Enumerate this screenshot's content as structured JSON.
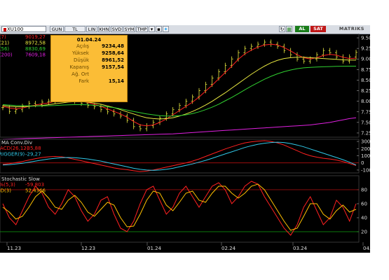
{
  "toolbar": {
    "symbol": "XU100",
    "period_buttons": [
      "GUN",
      "TL",
      "LIN",
      "KHN",
      "SVD",
      "SYM",
      "TMP"
    ],
    "al_label": "AL",
    "sat_label": "SAT",
    "brand": "MATRIKS",
    "colors": {
      "al": "#1a7d1a",
      "sat": "#c01818"
    }
  },
  "tooltip": {
    "date": "01.04.24",
    "rows": [
      {
        "key": "Açılış",
        "value": "9234,48"
      },
      {
        "key": "Yüksek",
        "value": "9258,64"
      },
      {
        "key": "Düşük",
        "value": "8961,52"
      },
      {
        "key": "Kapanış",
        "value": "9157,54"
      },
      {
        "key": "Ağ. Ort",
        "value": ""
      },
      {
        "key": "Fark",
        "value": "15,14"
      }
    ]
  },
  "chart_data": [
    {
      "type": "line",
      "panel": "price",
      "title": "",
      "ma_legend": [
        {
          "label": "V(7)",
          "value": "9019,27",
          "color": "#ff2020"
        },
        {
          "label": "V(21)",
          "value": "8972,58",
          "color": "#e8e840"
        },
        {
          "label": "V(56)",
          "value": "8830,69",
          "color": "#30d030"
        },
        {
          "label": "V(200)",
          "value": "7609,18",
          "color": "#e020e0"
        }
      ],
      "y_ticks": [
        "9.500",
        "9.250",
        "9.000",
        "8.750",
        "8.500",
        "8.250",
        "8.000",
        "7.750",
        "7.500",
        "7.250"
      ],
      "ylim": [
        7150,
        9600
      ],
      "x_ticks": [
        "11.23",
        "12.23",
        "01.24",
        "02.24",
        "03.24",
        "04.24"
      ],
      "close": [
        7850,
        7760,
        7800,
        7880,
        7950,
        7920,
        7980,
        8000,
        8050,
        8100,
        8060,
        8000,
        7950,
        7900,
        7870,
        7800,
        7750,
        7700,
        7650,
        7550,
        7400,
        7350,
        7420,
        7500,
        7600,
        7700,
        7800,
        7900,
        8000,
        8100,
        8250,
        8400,
        8550,
        8700,
        8850,
        9000,
        9150,
        9250,
        9300,
        9350,
        9400,
        9350,
        9300,
        9200,
        9100,
        9000,
        8950,
        9000,
        9100,
        9200,
        9150,
        9050,
        8950,
        9050,
        9157
      ],
      "series": [
        {
          "name": "V(7)",
          "color": "#ff2020",
          "values": [
            7880,
            7840,
            7820,
            7840,
            7880,
            7910,
            7940,
            7960,
            8000,
            8040,
            8050,
            8040,
            8010,
            7970,
            7930,
            7880,
            7820,
            7760,
            7700,
            7620,
            7520,
            7440,
            7420,
            7440,
            7500,
            7580,
            7680,
            7780,
            7880,
            7980,
            8100,
            8240,
            8380,
            8530,
            8680,
            8830,
            8990,
            9120,
            9210,
            9280,
            9330,
            9350,
            9330,
            9270,
            9190,
            9100,
            9030,
            9000,
            9030,
            9080,
            9110,
            9090,
            9040,
            9010,
            9019
          ]
        },
        {
          "name": "V(21)",
          "color": "#e8e840",
          "values": [
            7900,
            7880,
            7870,
            7870,
            7880,
            7890,
            7900,
            7920,
            7940,
            7960,
            7980,
            7990,
            7990,
            7980,
            7960,
            7930,
            7890,
            7850,
            7800,
            7750,
            7700,
            7650,
            7610,
            7590,
            7580,
            7590,
            7610,
            7650,
            7700,
            7760,
            7830,
            7910,
            8000,
            8100,
            8200,
            8310,
            8420,
            8530,
            8640,
            8740,
            8830,
            8910,
            8970,
            9010,
            9030,
            9040,
            9040,
            9030,
            9020,
            9010,
            9000,
            8990,
            8980,
            8975,
            8972
          ]
        },
        {
          "name": "V(56)",
          "color": "#30d030",
          "values": [
            7920,
            7910,
            7900,
            7895,
            7890,
            7890,
            7890,
            7895,
            7900,
            7910,
            7915,
            7920,
            7920,
            7915,
            7905,
            7890,
            7870,
            7850,
            7820,
            7790,
            7760,
            7730,
            7700,
            7680,
            7660,
            7650,
            7650,
            7660,
            7680,
            7710,
            7750,
            7800,
            7860,
            7930,
            8010,
            8090,
            8180,
            8270,
            8360,
            8440,
            8520,
            8590,
            8650,
            8700,
            8740,
            8770,
            8790,
            8800,
            8810,
            8815,
            8820,
            8825,
            8828,
            8830,
            8830
          ]
        },
        {
          "name": "V(200)",
          "color": "#e020e0",
          "values": [
            7100,
            7105,
            7110,
            7115,
            7120,
            7125,
            7130,
            7135,
            7140,
            7145,
            7150,
            7155,
            7160,
            7165,
            7170,
            7175,
            7180,
            7185,
            7190,
            7195,
            7200,
            7205,
            7210,
            7215,
            7220,
            7225,
            7230,
            7240,
            7250,
            7260,
            7270,
            7280,
            7290,
            7300,
            7310,
            7320,
            7330,
            7340,
            7350,
            7360,
            7370,
            7380,
            7390,
            7400,
            7410,
            7420,
            7430,
            7440,
            7460,
            7480,
            7500,
            7530,
            7560,
            7590,
            7609
          ]
        }
      ]
    },
    {
      "type": "line",
      "panel": "macd",
      "title": "MA Conv.Div",
      "legend": [
        {
          "label": "MACD(26,12)",
          "value": "-35,88",
          "color": "#ff2020"
        },
        {
          "label": "TRIGGER(9)",
          "value": "-29,27",
          "color": "#30c8e8"
        }
      ],
      "y_ticks": [
        "300",
        "200",
        "100",
        "0",
        "-100"
      ],
      "ylim": [
        -140,
        330
      ],
      "series": [
        {
          "name": "MACD(26,12)",
          "color": "#ff2020",
          "values": [
            -20,
            -10,
            5,
            20,
            40,
            60,
            75,
            85,
            90,
            85,
            70,
            50,
            30,
            10,
            -10,
            -30,
            -50,
            -70,
            -85,
            -95,
            -110,
            -120,
            -115,
            -100,
            -80,
            -60,
            -40,
            -20,
            0,
            25,
            55,
            90,
            125,
            160,
            195,
            225,
            255,
            280,
            295,
            305,
            310,
            300,
            280,
            250,
            210,
            170,
            130,
            100,
            80,
            65,
            55,
            40,
            20,
            -10,
            -36
          ]
        },
        {
          "name": "TRIGGER(9)",
          "color": "#30c8e8",
          "values": [
            -30,
            -25,
            -15,
            -5,
            10,
            25,
            40,
            55,
            65,
            72,
            75,
            72,
            65,
            55,
            40,
            25,
            5,
            -15,
            -35,
            -55,
            -75,
            -90,
            -100,
            -105,
            -100,
            -90,
            -75,
            -55,
            -35,
            -15,
            10,
            35,
            65,
            95,
            125,
            155,
            185,
            215,
            240,
            260,
            275,
            285,
            290,
            285,
            270,
            250,
            225,
            195,
            165,
            135,
            105,
            75,
            45,
            10,
            -29
          ]
        }
      ]
    },
    {
      "type": "line",
      "panel": "stochastic",
      "title": "Stochastic Slow",
      "legend": [
        {
          "label": "K%(5,3)",
          "value": "-59,803",
          "color": "#ff2020"
        },
        {
          "label": "%D(3)",
          "value": "52,4366",
          "color": "#ffc000"
        }
      ],
      "y_ticks": [
        "80",
        "60",
        "40",
        "20"
      ],
      "ylim": [
        5,
        100
      ],
      "series": [
        {
          "name": "K%(5,3)",
          "color": "#ff2020",
          "values": [
            60,
            40,
            30,
            50,
            70,
            85,
            75,
            55,
            45,
            60,
            80,
            70,
            50,
            35,
            45,
            65,
            70,
            45,
            25,
            20,
            35,
            60,
            80,
            85,
            65,
            45,
            55,
            75,
            85,
            70,
            55,
            70,
            85,
            90,
            80,
            60,
            70,
            85,
            92,
            88,
            70,
            55,
            40,
            25,
            15,
            30,
            55,
            70,
            50,
            30,
            40,
            65,
            55,
            35,
            60
          ]
        },
        {
          "name": "%D(3)",
          "color": "#ffc000",
          "values": [
            55,
            48,
            38,
            42,
            55,
            70,
            78,
            68,
            55,
            52,
            65,
            72,
            62,
            48,
            42,
            52,
            62,
            58,
            40,
            27,
            28,
            45,
            65,
            78,
            75,
            58,
            50,
            62,
            75,
            78,
            65,
            62,
            75,
            85,
            85,
            75,
            68,
            75,
            85,
            88,
            80,
            65,
            50,
            35,
            22,
            25,
            42,
            60,
            60,
            45,
            38,
            50,
            58,
            48,
            52
          ]
        }
      ]
    }
  ]
}
